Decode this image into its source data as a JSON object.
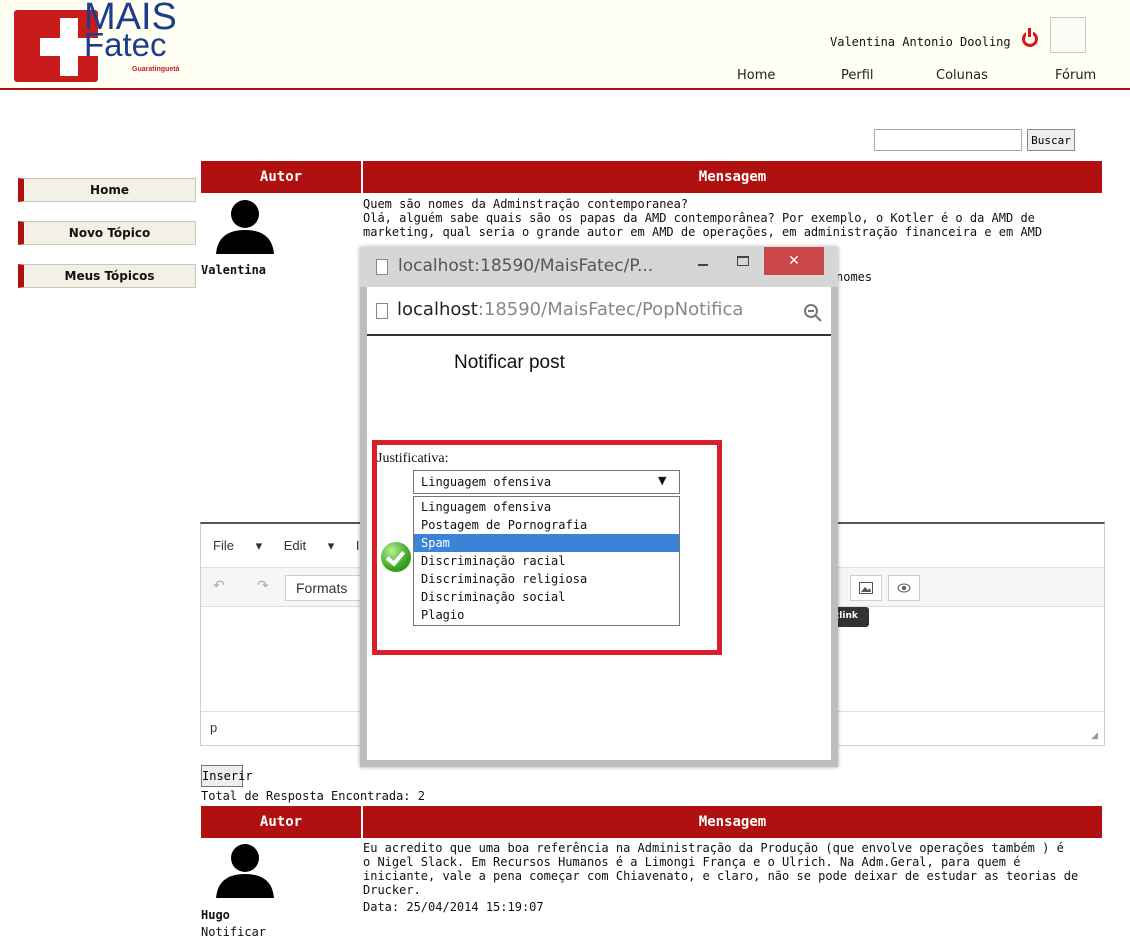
{
  "header": {
    "logo": {
      "line1": "MAIS",
      "line2": "Fatec",
      "line3": "Guaratinguetá"
    },
    "user_name": "Valentina Antonio Dooling",
    "nav": [
      "Home",
      "Perfil",
      "Colunas",
      "Fórum"
    ]
  },
  "search": {
    "button_label": "Buscar",
    "value": ""
  },
  "sidebar": {
    "items": [
      "Home",
      "Novo Tópico",
      "Meus Tópicos"
    ]
  },
  "topic_table": {
    "headers": [
      "Autor",
      "Mensagem"
    ],
    "author": "Valentina",
    "message_line1": "Quem são nomes da Adminstração contemporanea?",
    "message_line2": "Olá, alguém sabe quais são os papas da AMD contemporânea? Por exemplo, o Kotler é o da AMD de",
    "message_line3": "marketing, qual seria o grande autor em AMD de operações, em administração financeira e em AMD",
    "message_visible_end": "nomes"
  },
  "editor": {
    "menu": [
      "File",
      "Edit",
      "Ins"
    ],
    "formats_label": "Formats",
    "status_text": "p",
    "tooltip": "tlink"
  },
  "popup": {
    "title": "localhost:18590/MaisFatec/P...",
    "url_domain": "localhost",
    "url_path": ":18590/MaisFatec/PopNotifica",
    "close_label": "✕",
    "heading": "Notificar post",
    "justification_label": "Justificativa:",
    "selected_value": "Linguagem ofensiva",
    "options": [
      "Linguagem ofensiva",
      "Postagem de Pornografia",
      "Spam",
      "Discriminação racial",
      "Discriminação religiosa",
      "Discriminação social",
      "Plagio"
    ],
    "highlighted_option": "Spam"
  },
  "actions": {
    "insert_label": "Inserir"
  },
  "total_replies": "Total de Resposta Encontrada: 2",
  "reply_table": {
    "headers": [
      "Autor",
      "Mensagem"
    ],
    "author": "Hugo",
    "notify_label": "Notificar",
    "message_lines": [
      "Eu acredito que uma boa referência na Administração da Produção (que envolve operações também ) é",
      "o Nigel Slack. Em Recursos Humanos é a Limongi França e o Ulrich. Na Adm.Geral, para quem é",
      "iniciante, vale a pena começar com Chiavenato, e claro, não se pode deixar de estudar as teorias de",
      "Drucker."
    ],
    "date": "Data: 25/04/2014 15:19:07"
  },
  "colors": {
    "accent": "#b01010",
    "selection": "#3a83d6",
    "frame": "#d8202a"
  }
}
